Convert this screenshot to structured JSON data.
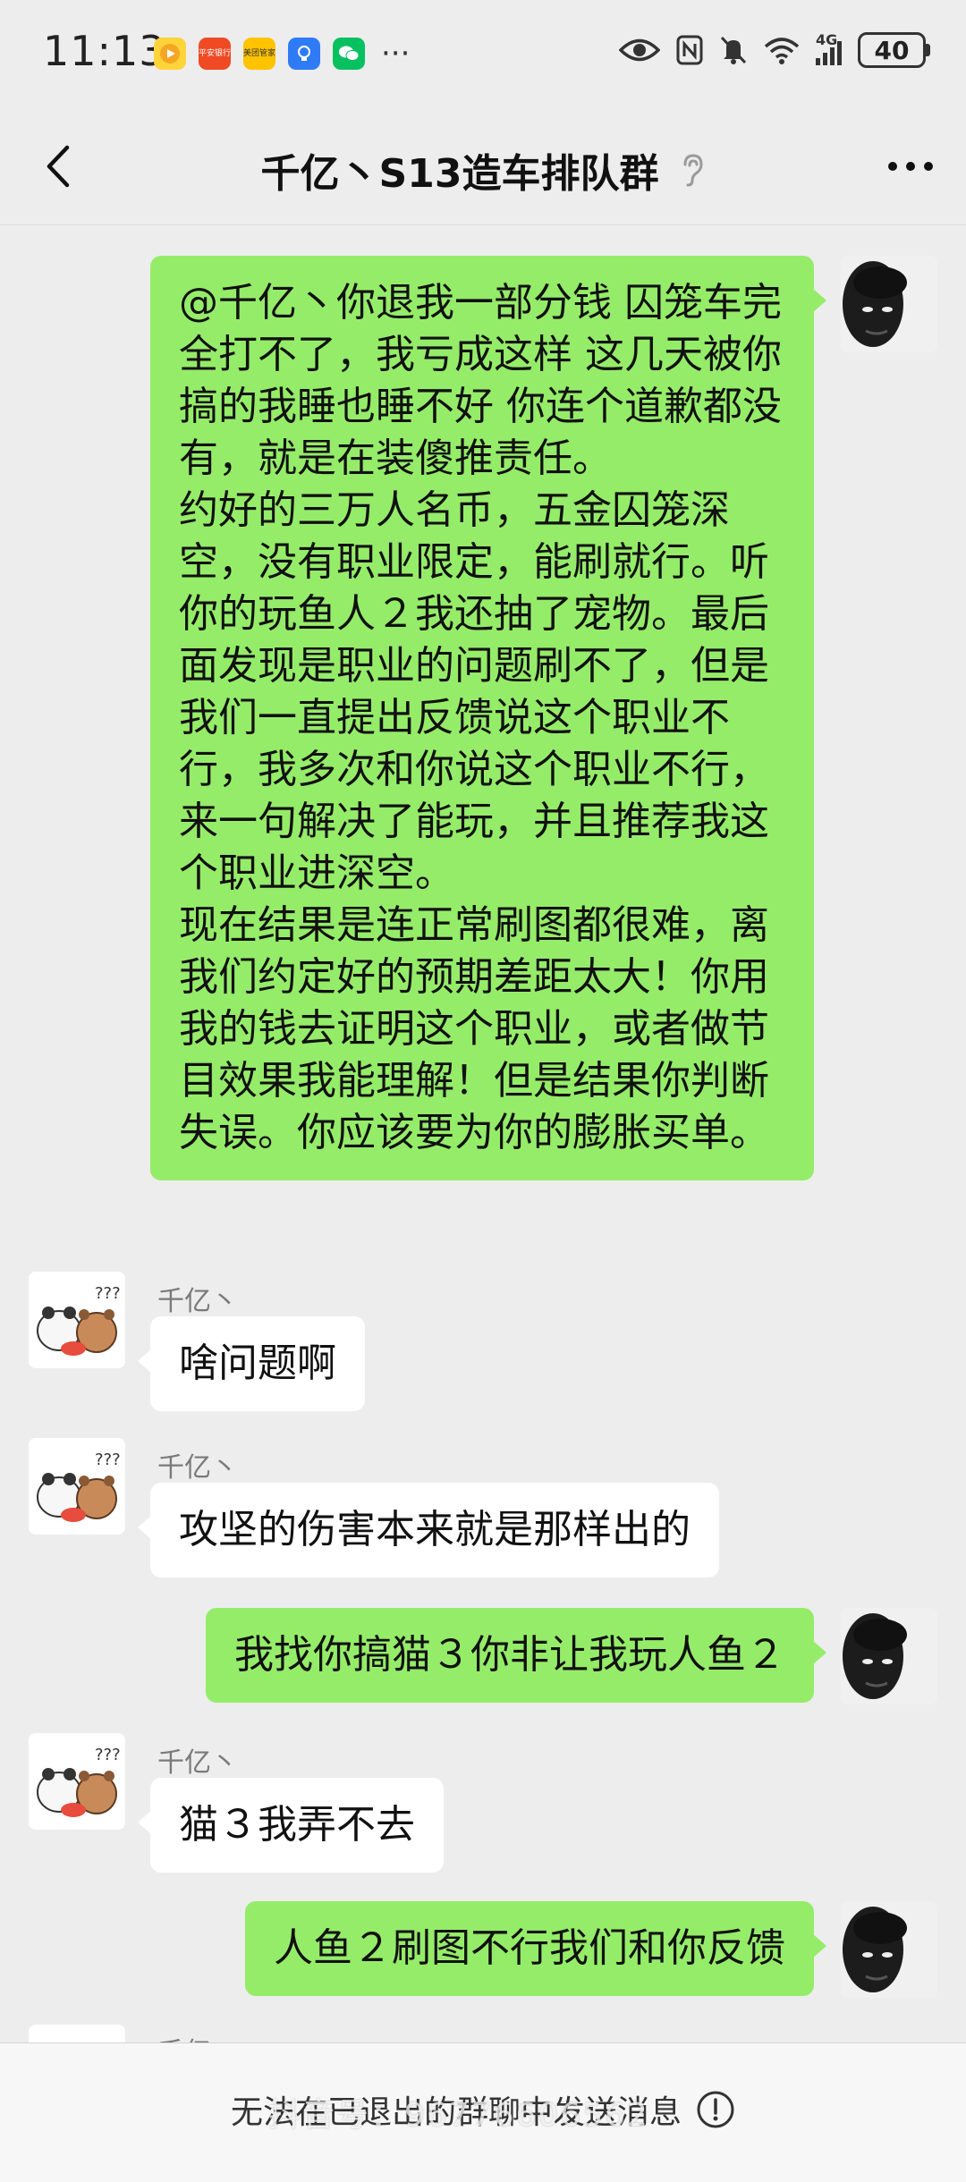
{
  "status_bar": {
    "time": "11:13",
    "app_icons": [
      "平安银行",
      "美团管家"
    ],
    "more": "···",
    "battery": "40",
    "network": "4G"
  },
  "header": {
    "back_icon": "chevron-left-icon",
    "title": "千亿丶S13造车排队群",
    "ear_icon": "ear-icon",
    "more_icon": "more-dots-icon"
  },
  "messages": [
    {
      "from": "me",
      "paragraphs": [
        "@千亿丶你退我一部分钱 囚笼车完全打不了，我亏成这样 这几天被你搞的我睡也睡不好 你连个道歉都没有，就是在装傻推责任。",
        "约好的三万人名币，五金囚笼深空，没有职业限定，能刷就行。听你的玩鱼人２我还抽了宠物。最后面发现是职业的问题刷不了，但是我们一直提出反馈说这个职业不行，我多次和你说这个职业不行，来一句解决了能玩，并且推荐我这个职业进深空。",
        "现在结果是连正常刷图都很难，离我们约定好的预期差距太大！你用我的钱去证明这个职业，或者做节目效果我能理解！但是结果你判断失误。你应该要为你的膨胀买单。"
      ]
    },
    {
      "from": "other",
      "sender": "千亿丶",
      "text": "啥问题啊"
    },
    {
      "from": "other",
      "sender": "千亿丶",
      "text": "攻坚的伤害本来就是那样出的"
    },
    {
      "from": "me",
      "text": "我找你搞猫３你非让我玩人鱼２"
    },
    {
      "from": "other",
      "sender": "千亿丶",
      "text": "猫３我弄不去"
    },
    {
      "from": "me",
      "text": "人鱼２刷图不行我们和你反馈"
    },
    {
      "from": "other",
      "sender": "千亿丶",
      "text": ""
    }
  ],
  "bottom": {
    "notice": "无法在已退出的群聊中发送消息",
    "info_icon": "info-icon",
    "watermark": "抖音号：96776606562"
  },
  "colors": {
    "my_bubble": "#95ec69",
    "other_bubble": "#ffffff",
    "background": "#ededed"
  }
}
